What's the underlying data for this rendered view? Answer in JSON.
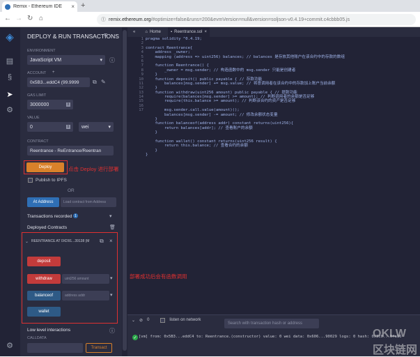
{
  "browser": {
    "tab_title": "Remix - Ethereum IDE",
    "url_prefix": "remix.",
    "url_host": "ethereum.org",
    "url_rest": "/#optimize=false&runs=200&evmVersion=null&version=soljson-v0.4.19+commit.c4cbbb05.js"
  },
  "panel": {
    "title": "DEPLOY & RUN TRANSACTIONS",
    "environment_label": "ENVIRONMENT",
    "environment_value": "JavaScript VM",
    "account_label": "ACCOUNT",
    "account_value": "0x5B3...eddC4 (99.9999",
    "gas_label": "GAS LIMIT",
    "gas_value": "3000000",
    "value_label": "VALUE",
    "value_value": "0",
    "value_unit": "wei",
    "contract_label": "CONTRACT",
    "contract_value": "Reentrance - ReEntrance/Reentran",
    "deploy_label": "Deploy",
    "deploy_note": "点击 Deploy 进行部署",
    "publish_label": "Publish to IPFS",
    "or_label": "OR",
    "at_address_label": "At Address",
    "at_address_placeholder": "Load contract from Address",
    "transactions_label": "Transactions recorded",
    "transactions_count": "1",
    "deployed_label": "Deployed Contracts",
    "instance_label": "REENTRANCE AT 0XD91...39138 (M",
    "fn_deposit": "deposit",
    "fn_withdraw": "withdraw",
    "fn_withdraw_placeholder": "uint256 amount",
    "fn_balanceof": "balanceof",
    "fn_balanceof_placeholder": "address addr",
    "fn_wallet": "wallet",
    "functions_note": "部署成功后会有函数调用",
    "low_level_label": "Low level interactions",
    "calldata_label": "CALLDATA",
    "transact_label": "Transact"
  },
  "editor": {
    "home_tab": "Home",
    "file_tab": "Reentrance.sol",
    "lines": [
      "pragma solidity ^0.4.19;",
      "",
      "contract Reentrance{",
      "    address _owner;",
      "    mapping (address => uint256) balances; // balances 是存放其他账户在该合约中的存款的数组",
      "",
      "    function Reentrance() {",
      "        _owner = msg.sender; // 构造函数中的 msg.sender 只能是创建者",
      "    }",
      "    function deposit() public payable { // 存款功能",
      "        balances[msg.sender] += msg.value; // 将意调用者在该合约中的存款加上账户当前余额",
      "    }",
      "    function withdraw(uint256 amount) public payable { // 提款功能",
      "        require(balances[msg.sender] >= amount); // 判断调用者的余额是否足够",
      "        require(this.balance >= amount); // 判断该合约的资产是否足够",
      "",
      "        msg.sender.call.value(amount)();",
      "        balances[msg.sender] -= amount; // 修改余额状态变量",
      "    }",
      "    function balanceof(address addr) constant returns(uint256){",
      "        return balances[addr]; // 查看账户的余额",
      "    }",
      "",
      "    function wallet() constant returns(uint256 result) {",
      "        return this.balance; // 查看合约的余额",
      "    }",
      "}"
    ],
    "line_numbers": [
      "1",
      "2",
      "3",
      "4",
      "5",
      "6",
      "7",
      "8",
      "9",
      "10",
      "11",
      "12",
      "13",
      "14",
      "15",
      "16",
      "17"
    ]
  },
  "terminal": {
    "count": "0",
    "listen_label": "listen on network",
    "search_placeholder": "Search with transaction hash or address",
    "log": "[vm]  from: 0x5B3...eddC4 to: Reentrance.(constructor) value: 0 wei data: 0x606...90029 logs: 0 hash: 0x3c0...0fa16"
  },
  "watermark": "OKLW 区块链网"
}
